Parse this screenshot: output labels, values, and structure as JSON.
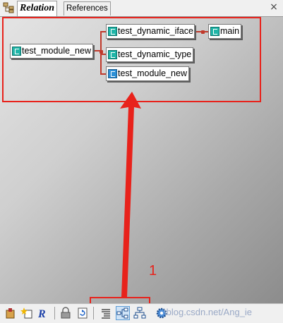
{
  "tabs": {
    "active_label": "Relation",
    "inactive_label": "References",
    "close_glyph": "×"
  },
  "graph": {
    "root": "test_module_new",
    "children": [
      "test_dynamic_iface",
      "test_dynamic_type",
      "test_module_new"
    ],
    "grandchild": "main"
  },
  "annotation": {
    "number": "1"
  },
  "watermark": "\\blog.csdn.net/Ang_ie",
  "colors": {
    "highlight": "#e8221b",
    "connector": "#c0392b",
    "node_icon": "#20b5a8"
  },
  "toolbar_icons": [
    "hand-icon",
    "star-class-icon",
    "r-icon",
    "lock-icon",
    "refresh-icon",
    "list-icon",
    "graph-icon",
    "tree-icon",
    "gear-icon"
  ]
}
